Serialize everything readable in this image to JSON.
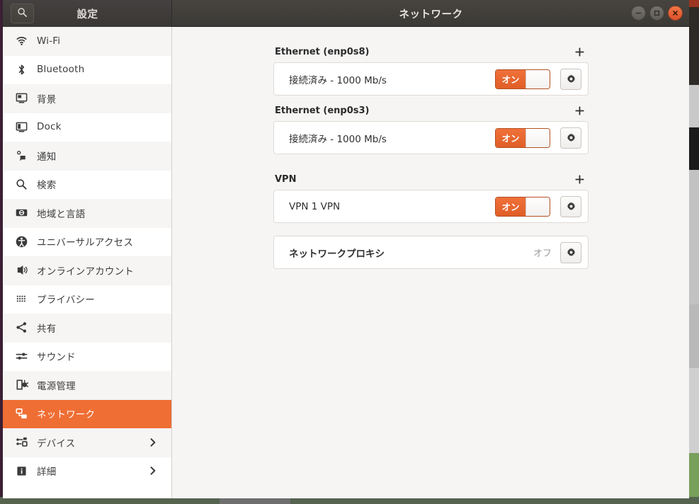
{
  "window": {
    "settings_title": "設定",
    "page_title": "ネットワーク",
    "search_icon": "search-icon",
    "controls": {
      "minimize": "minimize-button",
      "maximize": "maximize-button",
      "close": "close-button"
    }
  },
  "sidebar": {
    "items": [
      {
        "label": "Wi-Fi",
        "icon": "wifi-icon",
        "chevron": false,
        "selected": false
      },
      {
        "label": "Bluetooth",
        "icon": "bluetooth-icon",
        "chevron": false,
        "selected": false
      },
      {
        "label": "背景",
        "icon": "background-icon",
        "chevron": false,
        "selected": false
      },
      {
        "label": "Dock",
        "icon": "dock-icon",
        "chevron": false,
        "selected": false
      },
      {
        "label": "通知",
        "icon": "notifications-icon",
        "chevron": false,
        "selected": false
      },
      {
        "label": "検索",
        "icon": "search-icon",
        "chevron": false,
        "selected": false
      },
      {
        "label": "地域と言語",
        "icon": "region-language-icon",
        "chevron": false,
        "selected": false
      },
      {
        "label": "ユニバーサルアクセス",
        "icon": "universal-access-icon",
        "chevron": false,
        "selected": false
      },
      {
        "label": "オンラインアカウント",
        "icon": "online-accounts-icon",
        "chevron": false,
        "selected": false
      },
      {
        "label": "プライバシー",
        "icon": "privacy-icon",
        "chevron": false,
        "selected": false
      },
      {
        "label": "共有",
        "icon": "sharing-icon",
        "chevron": false,
        "selected": false
      },
      {
        "label": "サウンド",
        "icon": "sound-icon",
        "chevron": false,
        "selected": false
      },
      {
        "label": "電源管理",
        "icon": "power-icon",
        "chevron": false,
        "selected": false
      },
      {
        "label": "ネットワーク",
        "icon": "network-icon",
        "chevron": false,
        "selected": true
      },
      {
        "label": "デバイス",
        "icon": "devices-icon",
        "chevron": true,
        "selected": false
      },
      {
        "label": "詳細",
        "icon": "details-icon",
        "chevron": true,
        "selected": false
      }
    ]
  },
  "main": {
    "sections": [
      {
        "title": "Ethernet (enp0s8)",
        "add_label": "+",
        "row": {
          "label": "接続済み - 1000 Mb/s",
          "bold": false,
          "toggle": {
            "state_label": "オン",
            "on": true
          },
          "gear": "gear-icon"
        }
      },
      {
        "title": "Ethernet (enp0s3)",
        "add_label": "+",
        "row": {
          "label": "接続済み - 1000 Mb/s",
          "bold": false,
          "toggle": {
            "state_label": "オン",
            "on": true
          },
          "gear": "gear-icon"
        }
      },
      {
        "title": "VPN",
        "add_label": "+",
        "row": {
          "label": "VPN 1 VPN",
          "bold": false,
          "toggle": {
            "state_label": "オン",
            "on": true
          },
          "gear": "gear-icon"
        }
      }
    ],
    "proxy": {
      "label": "ネットワークプロキシ",
      "state_label": "オフ",
      "gear": "gear-icon"
    }
  },
  "colors": {
    "accent": "#ef6e34",
    "toggle_on": "#e05e26",
    "close_button": "#df512b",
    "headerbar": "#3c3a36",
    "content_bg": "#f6f5f4"
  }
}
